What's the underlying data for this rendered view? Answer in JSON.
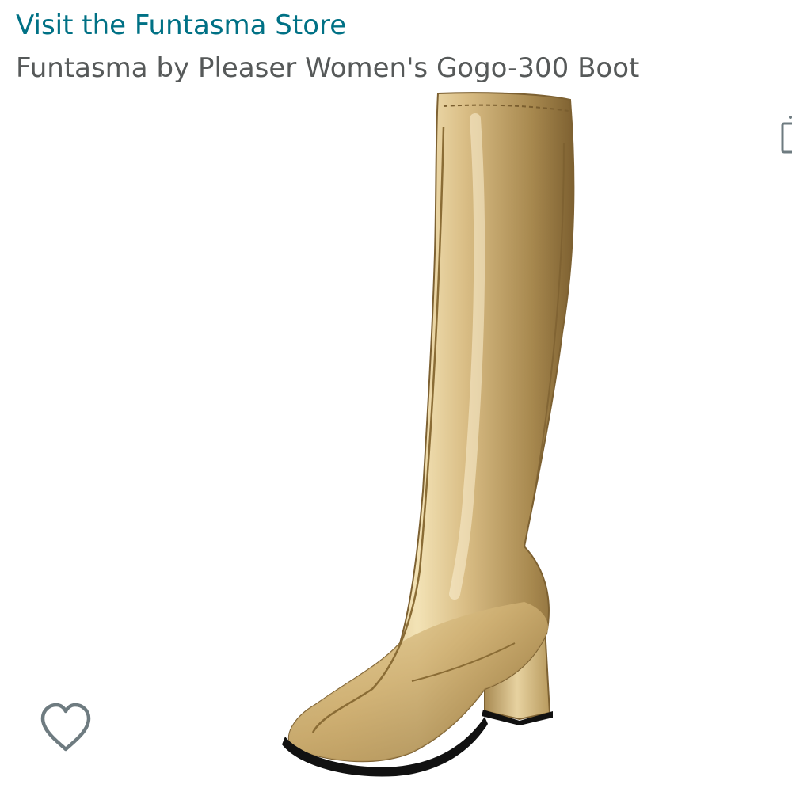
{
  "header": {
    "store_link": "Visit the Funtasma Store",
    "product_title": "Funtasma by Pleaser Women's Gogo-300 Boot"
  },
  "colors": {
    "link": "#007185",
    "title": "#565959",
    "gold_light": "#f1dfae",
    "gold_mid": "#c9a868",
    "gold_dark": "#8a6c35",
    "icon": "#6e7b80"
  },
  "icons": {
    "wishlist": "heart-outline-icon",
    "share": "share-icon"
  }
}
